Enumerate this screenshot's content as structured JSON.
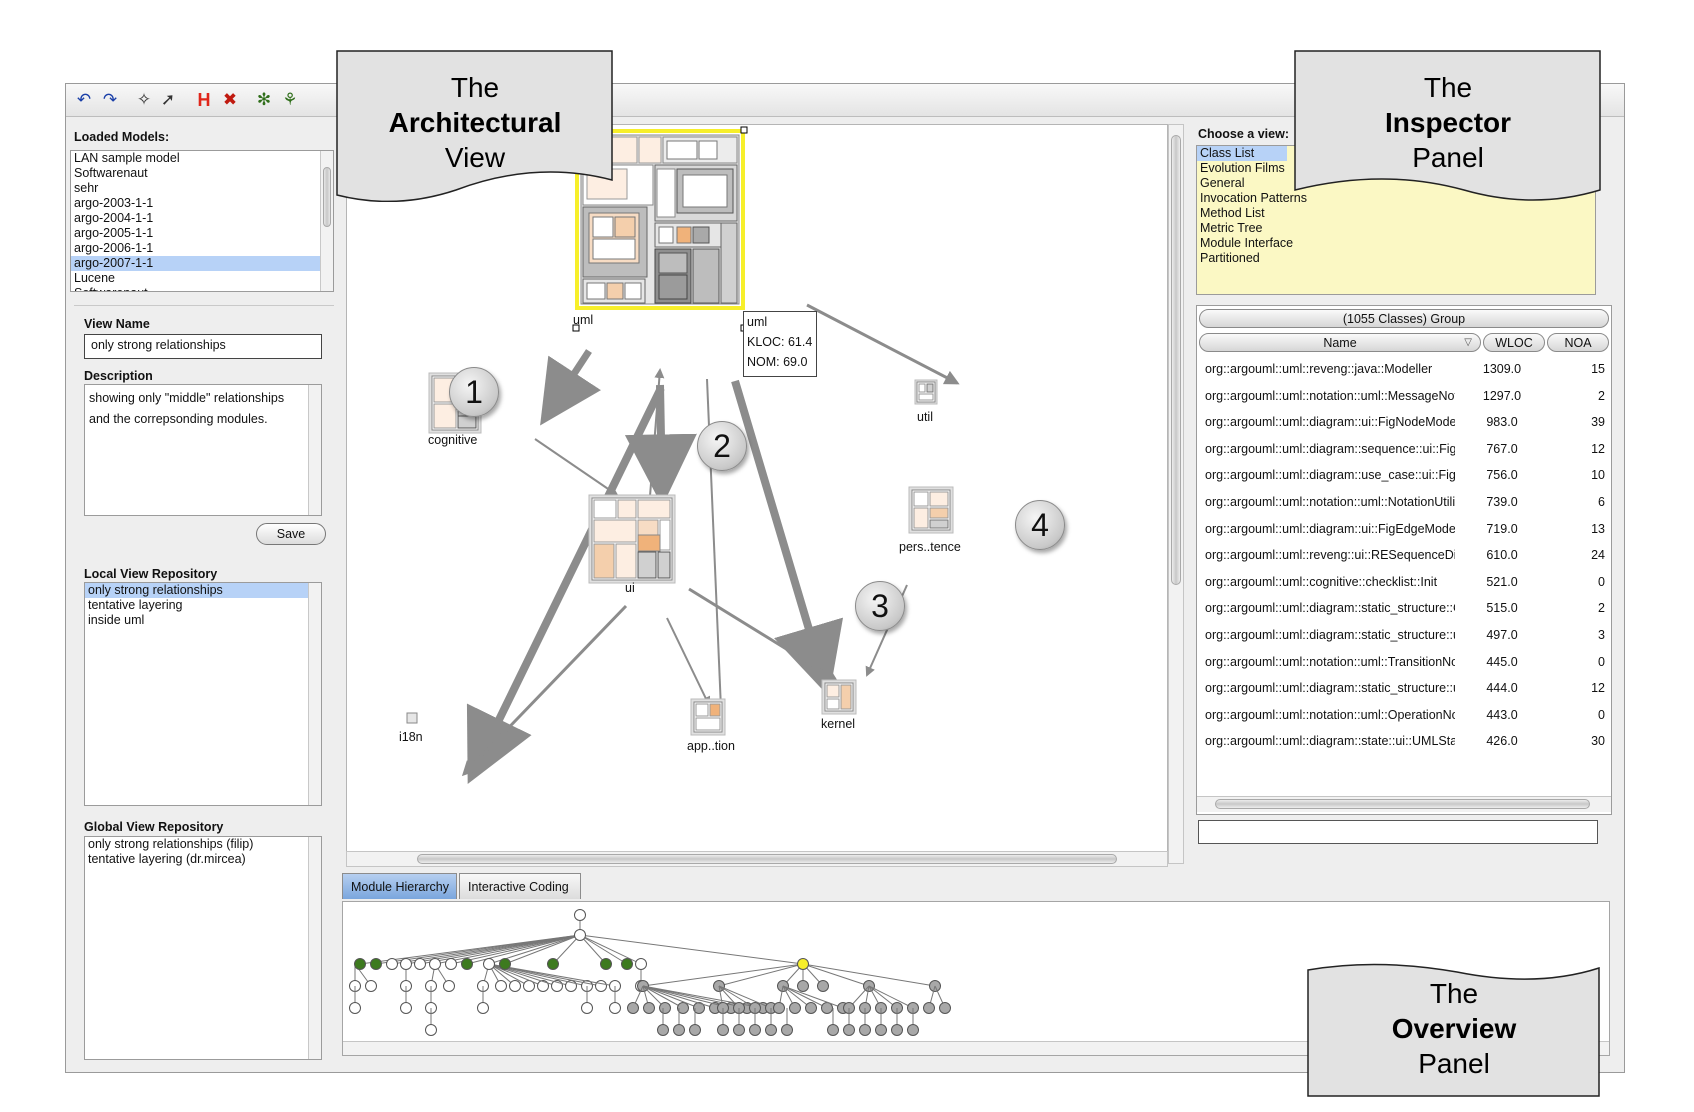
{
  "toolbar": {
    "buttons": [
      "undo-icon",
      "redo-icon",
      "lasso-icon",
      "pointer-icon",
      "hide-icon",
      "remove-icon",
      "expand-icon",
      "tree-icon"
    ]
  },
  "left_panel": {
    "loaded_models_label": "Loaded Models:",
    "loaded_models": [
      "LAN sample model",
      "Softwarenaut",
      "sehr",
      "argo-2003-1-1",
      "argo-2004-1-1",
      "argo-2005-1-1",
      "argo-2006-1-1",
      "argo-2007-1-1",
      "Lucene",
      "Softwarenaut"
    ],
    "loaded_models_selected_index": 7,
    "view_name_label": "View Name",
    "view_name_value": "only strong relationships",
    "description_label": "Description",
    "description_line1": "showing only \"middle\" relationships",
    "description_line2": "and the correpsonding modules.",
    "save_label": "Save",
    "local_repo_label": "Local View Repository",
    "local_repo_items": [
      "only strong relationships",
      "tentative layering",
      "inside uml"
    ],
    "local_repo_selected_index": 0,
    "global_repo_label": "Global View Repository",
    "global_repo_items": [
      "only strong relationships (filip)",
      "tentative layering (dr.mircea)"
    ]
  },
  "arch_view": {
    "nodes": {
      "uml": "uml",
      "cognitive": "cognitive",
      "ui": "ui",
      "util": "util",
      "persistence": "pers..tence",
      "i18n": "i18n",
      "application": "app..tion",
      "kernel": "kernel"
    },
    "tooltip": {
      "name": "uml",
      "kloc": "KLOC: 61.4",
      "nom": "NOM: 69.0"
    },
    "bubbles": [
      "1",
      "2",
      "3",
      "4"
    ]
  },
  "inspector": {
    "choose_view_label": "Choose a view:",
    "views": [
      "Class List",
      "Evolution Films",
      "General",
      "Invocation Patterns",
      "Method List",
      "Metric Tree",
      "Module Interface",
      "Partitioned"
    ],
    "selected_view_index": 0,
    "group_header": "(1055 Classes) Group",
    "columns": {
      "name": "Name",
      "wloc": "WLOC",
      "noa": "NOA"
    },
    "rows": [
      {
        "name": "org::argouml::uml::reveng::java::Modeller",
        "wloc": "1309.0",
        "noa": "15"
      },
      {
        "name": "org::argouml::uml::notation::uml::MessageNotat",
        "wloc": "1297.0",
        "noa": "2"
      },
      {
        "name": "org::argouml::uml::diagram::ui::FigNodeModelE",
        "wloc": "983.0",
        "noa": "39"
      },
      {
        "name": "org::argouml::uml::diagram::sequence::ui::FigC",
        "wloc": "767.0",
        "noa": "12"
      },
      {
        "name": "org::argouml::uml::diagram::use_case::ui::FigU",
        "wloc": "756.0",
        "noa": "10"
      },
      {
        "name": "org::argouml::uml::notation::uml::NotationUtility",
        "wloc": "739.0",
        "noa": "6"
      },
      {
        "name": "org::argouml::uml::diagram::ui::FigEdgeModelE",
        "wloc": "719.0",
        "noa": "13"
      },
      {
        "name": "org::argouml::uml::reveng::ui::RESequenceDia",
        "wloc": "610.0",
        "noa": "24"
      },
      {
        "name": "org::argouml::uml::cognitive::checklist::Init",
        "wloc": "521.0",
        "noa": "0"
      },
      {
        "name": "org::argouml::uml::diagram::static_structure::Cl",
        "wloc": "515.0",
        "noa": "2"
      },
      {
        "name": "org::argouml::uml::diagram::static_structure::ui:",
        "wloc": "497.0",
        "noa": "3"
      },
      {
        "name": "org::argouml::uml::notation::uml::TransitionNota",
        "wloc": "445.0",
        "noa": "0"
      },
      {
        "name": "org::argouml::uml::diagram::static_structure::ui:",
        "wloc": "444.0",
        "noa": "12"
      },
      {
        "name": "org::argouml::uml::notation::uml::OperationNota",
        "wloc": "443.0",
        "noa": "0"
      },
      {
        "name": "org::argouml::uml::diagram::state::ui::UMLState",
        "wloc": "426.0",
        "noa": "30"
      }
    ]
  },
  "overview": {
    "tabs": [
      "Module Hierarchy",
      "Interactive Coding"
    ],
    "active_tab": 0
  },
  "callouts": {
    "architectural": {
      "line1": "The",
      "line2": "Architectural",
      "line3": "View"
    },
    "inspector": {
      "line1": "The",
      "line2": "Inspector",
      "line3": "Panel"
    },
    "overview": {
      "line1": "The",
      "line2": "Overview",
      "line3": "Panel"
    }
  },
  "colors": {
    "selection": "#b7d2f7",
    "view_list_bg": "#fbf8c4",
    "highlight_yellow": "#f7ef2a",
    "tree_green": "#3d7a1f",
    "tree_gray": "#a8a8a8",
    "treemap_orange": "#f0b27a"
  }
}
